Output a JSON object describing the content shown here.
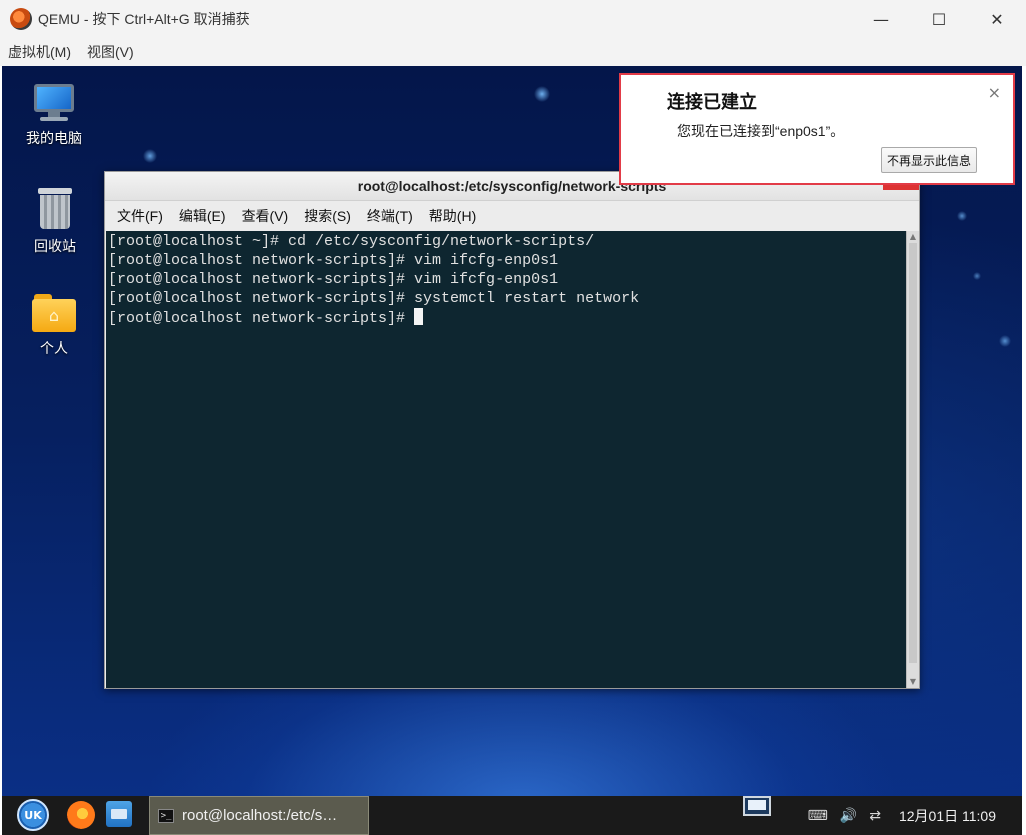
{
  "host": {
    "title": "QEMU - 按下 Ctrl+Alt+G 取消捕获",
    "menu": [
      "虚拟机(M)",
      "视图(V)"
    ],
    "controls": {
      "minimize": "—",
      "maximize": "☐",
      "close": "✕"
    }
  },
  "desktop": {
    "icons": [
      {
        "label": "我的电脑",
        "icon": "computer-icon"
      },
      {
        "label": "回收站",
        "icon": "trash-icon"
      },
      {
        "label": "个人",
        "icon": "home-folder-icon"
      }
    ]
  },
  "terminal": {
    "title": "root@localhost:/etc/sysconfig/network-scripts",
    "menu": [
      "文件(F)",
      "编辑(E)",
      "查看(V)",
      "搜索(S)",
      "终端(T)",
      "帮助(H)"
    ],
    "lines": [
      "[root@localhost ~]# cd /etc/sysconfig/network-scripts/",
      "[root@localhost network-scripts]# vim ifcfg-enp0s1",
      "[root@localhost network-scripts]# vim ifcfg-enp0s1",
      "[root@localhost network-scripts]# systemctl restart network",
      "[root@localhost network-scripts]# "
    ]
  },
  "notification": {
    "title": "连接已建立",
    "message": "您现在已连接到“enp0s1”。",
    "button": "不再显示此信息",
    "close": "×"
  },
  "taskbar": {
    "start": "UK",
    "task_label": "root@localhost:/etc/s…",
    "task_icon": ">_",
    "tray": {
      "keyboard": "⌨",
      "volume": "🔊",
      "network": "⇄"
    },
    "clock": "12月01日 11:09"
  },
  "colors": {
    "terminal_bg": "#0e2630",
    "notification_border": "#e23b47",
    "taskbar_bg": "#1a1a1a"
  }
}
